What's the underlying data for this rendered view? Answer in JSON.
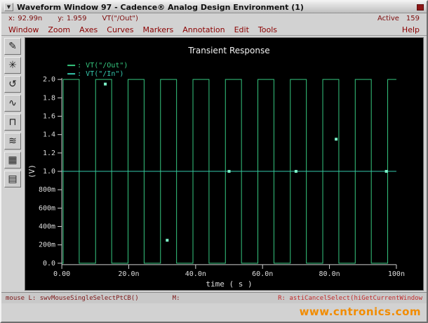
{
  "window": {
    "title": "Waveform Window 97 - Cadence® Analog Design Environment (1)"
  },
  "info_bar": {
    "x_label": "x:",
    "x_value": "92.99n",
    "y_label": "y:",
    "y_value": "1.959",
    "trace": "VT(\"/Out\")",
    "active_label": "Active",
    "active_value": "159"
  },
  "menu": {
    "items": [
      "Window",
      "Zoom",
      "Axes",
      "Curves",
      "Markers",
      "Annotation",
      "Edit",
      "Tools"
    ],
    "help": "Help"
  },
  "toolbar": {
    "icons": [
      {
        "id": "select-pen",
        "glyph": "✎"
      },
      {
        "id": "zoom-point",
        "glyph": "✳"
      },
      {
        "id": "refresh",
        "glyph": "↺"
      },
      {
        "id": "strip-plot",
        "glyph": "∿"
      },
      {
        "id": "composite-plot",
        "glyph": "⊓"
      },
      {
        "id": "subplot",
        "glyph": "≋"
      },
      {
        "id": "calculator-grid",
        "glyph": "▦"
      },
      {
        "id": "data-table",
        "glyph": "▤"
      }
    ]
  },
  "chart_data": {
    "type": "line",
    "title": "Transient Response",
    "xlabel": "time ( s )",
    "ylabel": "(V)",
    "xlim_ns": [
      0,
      100
    ],
    "ylim_v": [
      0,
      2.0
    ],
    "grid": false,
    "legend_position": "top-left",
    "x_ticks": [
      {
        "t": 0,
        "label": "0.00"
      },
      {
        "t": 20,
        "label": "20.0n"
      },
      {
        "t": 40,
        "label": "40.0n"
      },
      {
        "t": 60,
        "label": "60.0n"
      },
      {
        "t": 80,
        "label": "80.0n"
      },
      {
        "t": 100,
        "label": "100n"
      }
    ],
    "y_ticks": [
      {
        "v": 2.0,
        "label": "2.0"
      },
      {
        "v": 1.8,
        "label": "1.8"
      },
      {
        "v": 1.6,
        "label": "1.6"
      },
      {
        "v": 1.4,
        "label": "1.4"
      },
      {
        "v": 1.2,
        "label": "1.2"
      },
      {
        "v": 1.0,
        "label": "1.0"
      },
      {
        "v": 0.8,
        "label": "800m"
      },
      {
        "v": 0.6,
        "label": "600m"
      },
      {
        "v": 0.4,
        "label": "400m"
      },
      {
        "v": 0.2,
        "label": "200m"
      },
      {
        "v": 0.0,
        "label": "0.0"
      }
    ],
    "series": [
      {
        "name": "VT(\"/Out\")",
        "color": "#35c77f",
        "waveform": "square",
        "t_first_rise_ns": 0.4,
        "period_ns": 9.7,
        "high_width_ns": 4.8,
        "low_v": 0.0,
        "high_v": 2.0
      },
      {
        "name": "VT(\"/In\")",
        "color": "#35c7ad",
        "waveform": "constant",
        "value_v": 1.0
      }
    ],
    "marker_color": "#7df2c8",
    "markers": [
      {
        "t_ns": 13,
        "v": 1.95
      },
      {
        "t_ns": 31.5,
        "v": 0.25
      },
      {
        "t_ns": 50,
        "v": 1.0
      },
      {
        "t_ns": 70,
        "v": 1.0
      },
      {
        "t_ns": 82,
        "v": 1.35
      },
      {
        "t_ns": 97,
        "v": 1.0
      }
    ]
  },
  "status_bar": {
    "left": "mouse L:  swvMouseSingleSelectPtCB()",
    "middle": "M:",
    "right": "R: astiCancelSelect(hiGetCurrentWindow"
  },
  "watermark": "www.cntronics.com"
}
